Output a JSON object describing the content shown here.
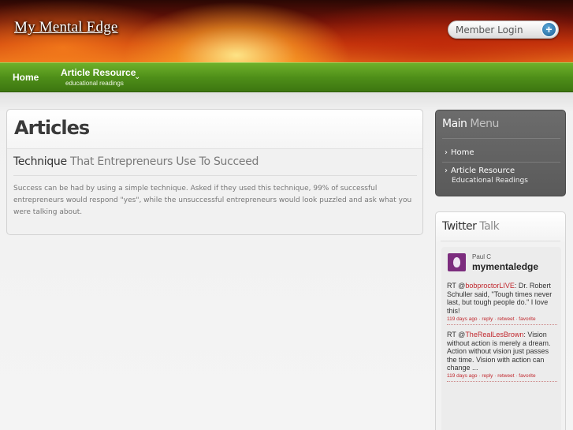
{
  "header": {
    "logo": "My Mental Edge",
    "member_login": "Member Login",
    "member_login_icon": "plus-circle-icon"
  },
  "nav": {
    "home": "Home",
    "article_resource": "Article Resource",
    "article_resource_sub": "educational readings",
    "chevron_icon": "chevron-down-icon"
  },
  "main": {
    "title": "Articles",
    "article": {
      "title_emphasis": "Technique",
      "title_rest": " That Entrepreneurs Use To Succeed",
      "body": "Success can be had by using a simple technique. Asked if they used this technique, 99% of successful entrepreneurs would respond \"yes\", while the unsuccessful entrepreneurs would look puzzled and ask what you were talking about."
    }
  },
  "sidebar": {
    "main_menu": {
      "title_main": "Main",
      "title_rest": " Menu",
      "items": [
        {
          "label": "Home"
        },
        {
          "label": "Article Resource",
          "sub": "Educational Readings"
        }
      ]
    },
    "twitter": {
      "title_main": "Twitter",
      "title_rest": " Talk",
      "user_name": "Paul C",
      "handle": "mymentaledge",
      "tweets": [
        {
          "prefix": "RT @",
          "mention": "bobproctorLIVE",
          "text": ": Dr. Robert Schuller said, \"Tough times never last, but tough people do.\" I love this!",
          "meta": "119 days ago · reply · retweet · favorite"
        },
        {
          "prefix": "RT @",
          "mention": "TheRealLesBrown",
          "text": ": Vision without action is merely a dream. Action without vision just passes the time. Vision with action can change ...",
          "meta": "119 days ago · reply · retweet · favorite"
        }
      ]
    }
  },
  "colors": {
    "nav_green": "#4f8f19",
    "sidebar_dark": "#5f5f5f",
    "link_red": "#c1272d"
  }
}
